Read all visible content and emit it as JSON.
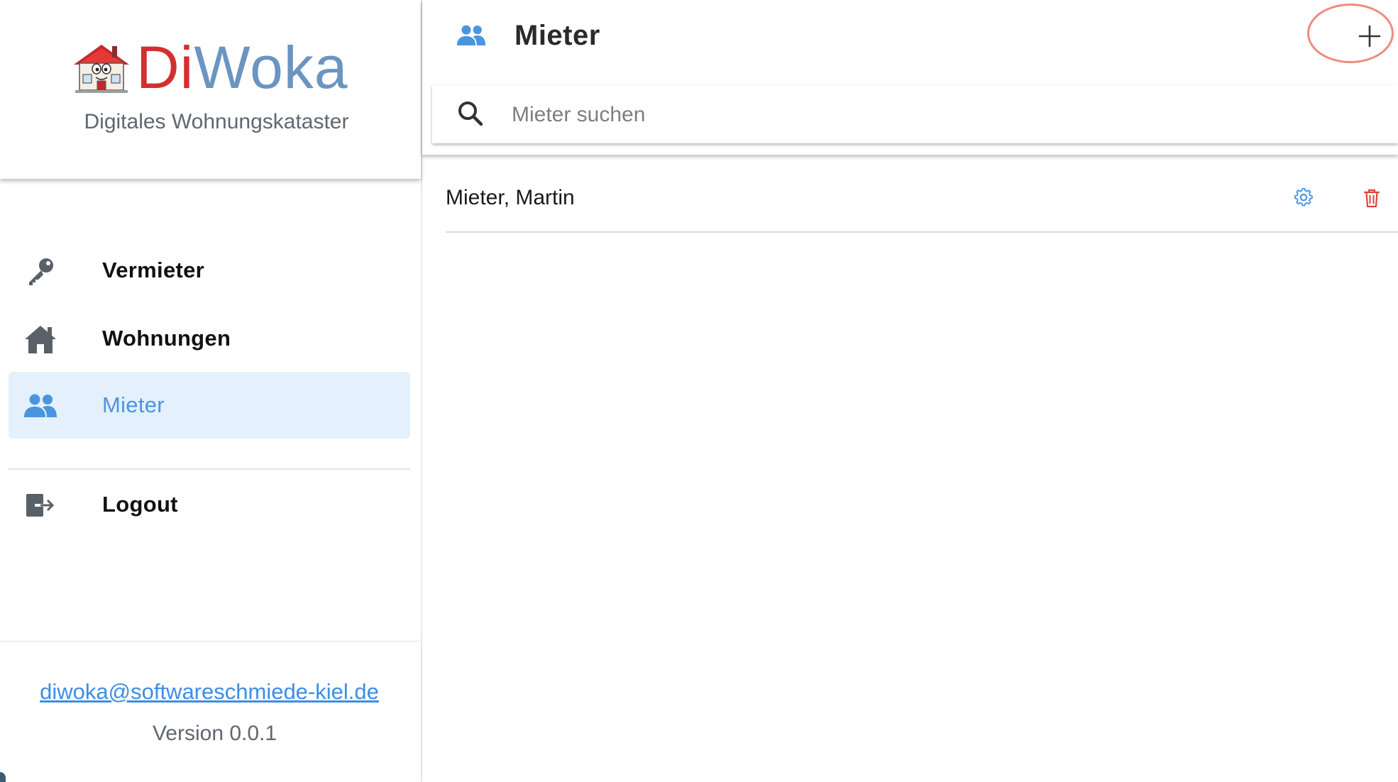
{
  "brand": {
    "logo_di": "Di",
    "logo_woka": "Woka",
    "tagline": "Digitales Wohnungskataster",
    "colors": {
      "di": "#d32f2f",
      "woka": "#6a95c2"
    }
  },
  "sidebar": {
    "items": [
      {
        "label": "Vermieter",
        "icon": "key-icon",
        "active": false
      },
      {
        "label": "Wohnungen",
        "icon": "home-icon",
        "active": false
      },
      {
        "label": "Mieter",
        "icon": "people-icon",
        "active": true
      },
      {
        "label": "Logout",
        "icon": "logout-icon",
        "active": false
      }
    ]
  },
  "footer": {
    "email": "diwoka@softwareschmiede-kiel.de",
    "version": "Version 0.0.1"
  },
  "main": {
    "title": "Mieter",
    "title_icon": "people-icon",
    "add_icon": "plus-icon",
    "search": {
      "placeholder": "Mieter suchen",
      "value": ""
    },
    "tenants": [
      {
        "name": "Mieter, Martin"
      }
    ]
  },
  "colors": {
    "accent": "#4a95e0",
    "active_bg": "#e4f0fc",
    "delete": "#e0433a",
    "highlight": "#ef8b7e",
    "icon_gray": "#5a6068"
  }
}
